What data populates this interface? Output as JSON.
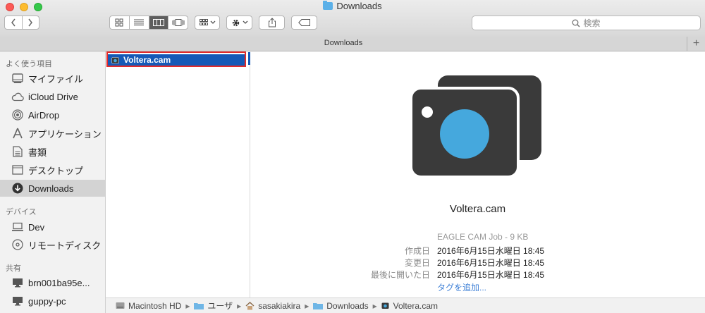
{
  "window": {
    "title": "Downloads"
  },
  "toolbar": {
    "search_placeholder": "検索"
  },
  "tabbar": {
    "title": "Downloads",
    "add": "+"
  },
  "sidebar": {
    "favorites_header": "よく使う項目",
    "favorites": [
      {
        "label": "マイファイル",
        "icon": "all-my-files-icon"
      },
      {
        "label": "iCloud Drive",
        "icon": "cloud-icon"
      },
      {
        "label": "AirDrop",
        "icon": "airdrop-icon"
      },
      {
        "label": "アプリケーション",
        "icon": "applications-icon"
      },
      {
        "label": "書類",
        "icon": "documents-icon"
      },
      {
        "label": "デスクトップ",
        "icon": "desktop-icon"
      },
      {
        "label": "Downloads",
        "icon": "downloads-icon",
        "selected": true
      }
    ],
    "devices_header": "デバイス",
    "devices": [
      {
        "label": "Dev",
        "icon": "computer-icon"
      },
      {
        "label": "リモートディスク",
        "icon": "disc-icon"
      }
    ],
    "shared_header": "共有",
    "shared": [
      {
        "label": "brn001ba95e...",
        "icon": "monitor-icon"
      },
      {
        "label": "guppy-pc",
        "icon": "monitor-icon"
      }
    ]
  },
  "column": {
    "file": "Voltera.cam"
  },
  "preview": {
    "name": "Voltera.cam",
    "kind": "EAGLE CAM Job - 9 KB",
    "meta": [
      {
        "key": "作成日",
        "value": "2016年6月15日水曜日 18:45"
      },
      {
        "key": "変更日",
        "value": "2016年6月15日水曜日 18:45"
      },
      {
        "key": "最後に開いた日",
        "value": "2016年6月15日水曜日 18:45"
      }
    ],
    "tags_link": "タグを追加..."
  },
  "pathbar": {
    "items": [
      "Macintosh HD",
      "ユーザ",
      "sasakiakira",
      "Downloads",
      "Voltera.cam"
    ],
    "separator": "▸"
  },
  "colors": {
    "selection": "#1559b7",
    "highlight_box": "#e12b2b",
    "camera_body": "#3a3a3a",
    "camera_lens": "#45a8dd"
  }
}
